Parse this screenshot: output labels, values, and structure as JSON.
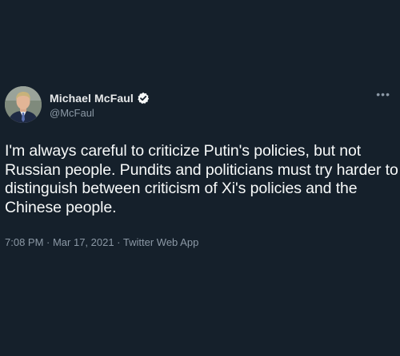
{
  "author": {
    "name": "Michael McFaul",
    "handle": "@McFaul",
    "verified_icon": "verified-badge-icon",
    "avatar_icon": "profile-photo"
  },
  "menu": {
    "more_label": "•••"
  },
  "tweet": {
    "text": "I'm always careful to criticize Putin's policies, but not Russian people.  Pundits and politicians must try harder to distinguish between criticism of Xi's policies and the Chinese people.",
    "timestamp": "7:08 PM · Mar 17, 2021 · Twitter Web App"
  },
  "colors": {
    "background": "#15202b",
    "text_primary": "#f7f9f9",
    "text_secondary": "#8b98a5"
  }
}
